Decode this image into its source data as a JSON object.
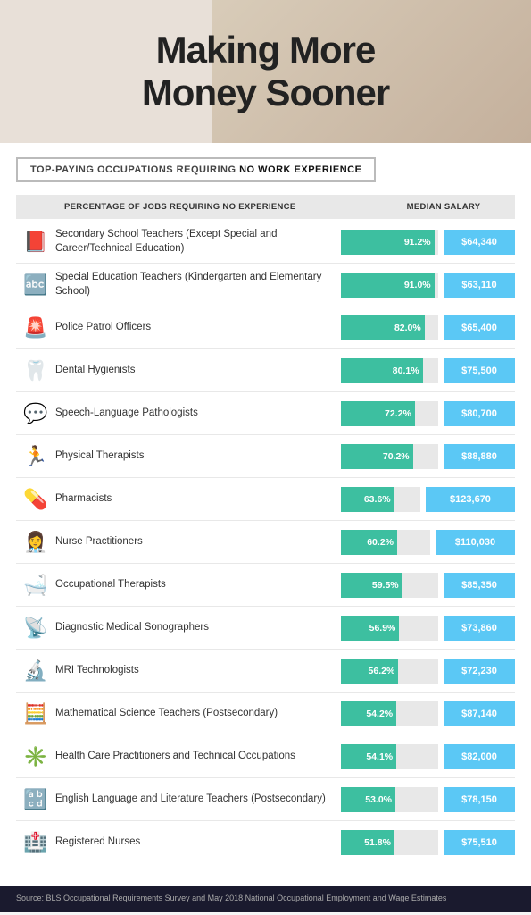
{
  "hero": {
    "title_line1": "Making More",
    "title_line2": "Money Sooner"
  },
  "subtitle": {
    "prefix": "TOP-PAYING OCCUPATIONS REQUIRING ",
    "highlight": "NO WORK EXPERIENCE"
  },
  "col_headers": {
    "pct_label": "PERCENTAGE OF JOBS REQUIRING NO EXPERIENCE",
    "sal_label": "MEDIAN SALARY"
  },
  "rows": [
    {
      "icon": "📕",
      "label": "Secondary School Teachers (Except Special and Career/Technical Education)",
      "pct": "91.2%",
      "pct_val": 91.2,
      "salary": "$64,340"
    },
    {
      "icon": "🔤",
      "label": "Special Education Teachers (Kindergarten and Elementary School)",
      "pct": "91.0%",
      "pct_val": 91.0,
      "salary": "$63,110"
    },
    {
      "icon": "🚨",
      "label": "Police Patrol Officers",
      "pct": "82.0%",
      "pct_val": 82.0,
      "salary": "$65,400"
    },
    {
      "icon": "🦷",
      "label": "Dental Hygienists",
      "pct": "80.1%",
      "pct_val": 80.1,
      "salary": "$75,500"
    },
    {
      "icon": "💬",
      "label": "Speech-Language Pathologists",
      "pct": "72.2%",
      "pct_val": 72.2,
      "salary": "$80,700"
    },
    {
      "icon": "🏃",
      "label": "Physical Therapists",
      "pct": "70.2%",
      "pct_val": 70.2,
      "salary": "$88,880"
    },
    {
      "icon": "💊",
      "label": "Pharmacists",
      "pct": "63.6%",
      "pct_val": 63.6,
      "salary": "$123,670"
    },
    {
      "icon": "👩‍⚕️",
      "label": "Nurse Practitioners",
      "pct": "60.2%",
      "pct_val": 60.2,
      "salary": "$110,030"
    },
    {
      "icon": "🛁",
      "label": "Occupational Therapists",
      "pct": "59.5%",
      "pct_val": 59.5,
      "salary": "$85,350"
    },
    {
      "icon": "📡",
      "label": "Diagnostic Medical Sonographers",
      "pct": "56.9%",
      "pct_val": 56.9,
      "salary": "$73,860"
    },
    {
      "icon": "🔬",
      "label": "MRI Technologists",
      "pct": "56.2%",
      "pct_val": 56.2,
      "salary": "$72,230"
    },
    {
      "icon": "🧮",
      "label": "Mathematical Science Teachers (Postsecondary)",
      "pct": "54.2%",
      "pct_val": 54.2,
      "salary": "$87,140"
    },
    {
      "icon": "✳️",
      "label": "Health Care Practitioners and Technical Occupations",
      "pct": "54.1%",
      "pct_val": 54.1,
      "salary": "$82,000"
    },
    {
      "icon": "🔡",
      "label": "English Language and Literature Teachers (Postsecondary)",
      "pct": "53.0%",
      "pct_val": 53.0,
      "salary": "$78,150"
    },
    {
      "icon": "🏥",
      "label": "Registered Nurses",
      "pct": "51.8%",
      "pct_val": 51.8,
      "salary": "$75,510"
    }
  ],
  "footer": {
    "source_label": "Source:",
    "source_text": " BLS Occupational Requirements Survey and May 2018 National Occupational Employment and Wage Estimates"
  },
  "max_pct": 95
}
